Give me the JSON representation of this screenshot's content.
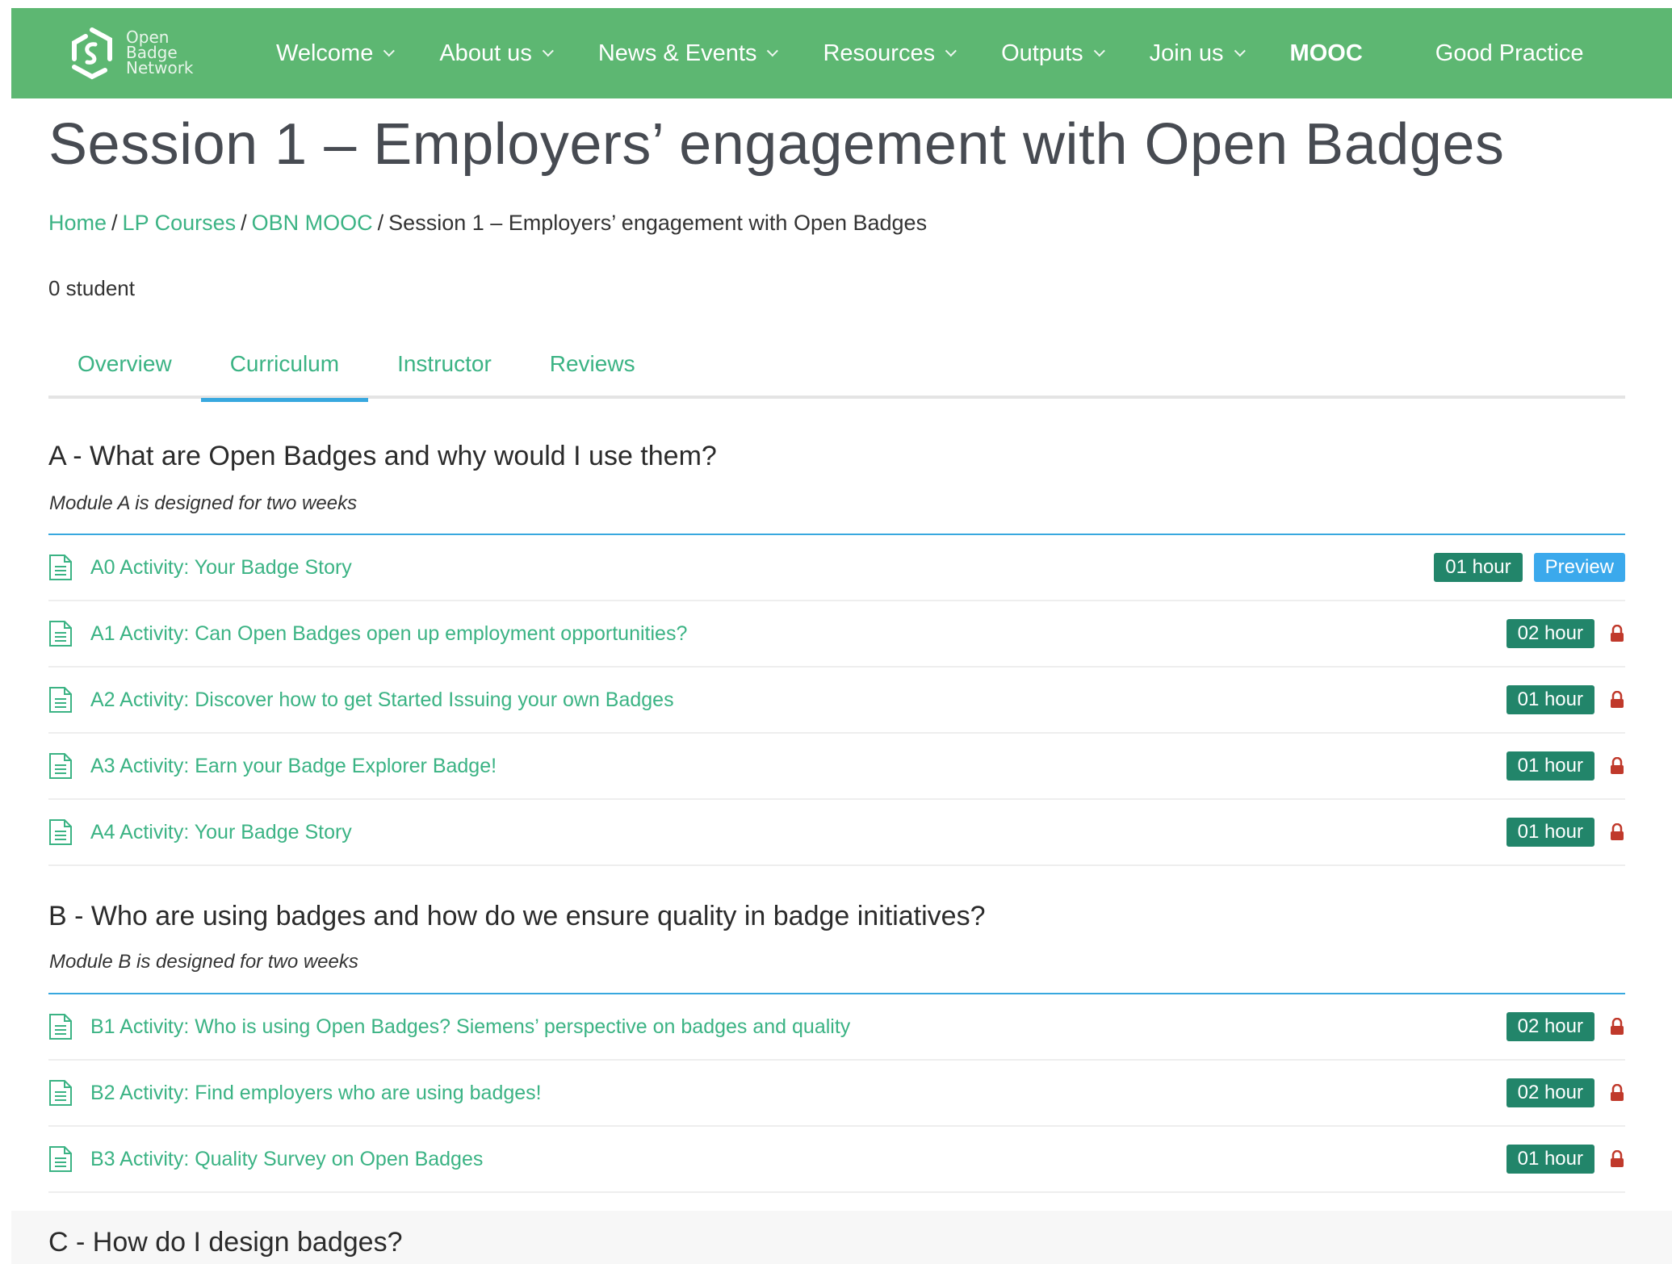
{
  "logo": {
    "text_line1": "Open",
    "text_line2": "Badge",
    "text_line3": "Network",
    "icon": "open-badge-network-logo"
  },
  "nav": [
    {
      "label": "Welcome",
      "has_dropdown": true
    },
    {
      "label": "About us",
      "has_dropdown": true
    },
    {
      "label": "News & Events",
      "has_dropdown": true
    },
    {
      "label": "Resources",
      "has_dropdown": true
    },
    {
      "label": "Outputs",
      "has_dropdown": true
    },
    {
      "label": "Join us",
      "has_dropdown": true
    },
    {
      "label": "MOOC",
      "has_dropdown": false,
      "active": true
    },
    {
      "label": "Good Practice",
      "has_dropdown": false
    }
  ],
  "page_title": "Session 1 – Employers’ engagement with Open Badges",
  "breadcrumb": {
    "home": "Home",
    "lp_courses": "LP Courses",
    "obn_mooc": "OBN MOOC",
    "current": "Session 1 – Employers’ engagement with Open Badges",
    "separator": "/"
  },
  "students": "0 student",
  "tabs": [
    {
      "label": "Overview"
    },
    {
      "label": "Curriculum",
      "active": true
    },
    {
      "label": "Instructor"
    },
    {
      "label": "Reviews"
    }
  ],
  "sections": [
    {
      "title": "A - What are Open Badges and why would I use them?",
      "description": "Module A is designed for two weeks",
      "items": [
        {
          "label": "A0 Activity: Your Badge Story",
          "duration": "01 hour",
          "preview": "Preview",
          "locked": false
        },
        {
          "label": "A1 Activity: Can Open Badges open up employment opportunities?",
          "duration": "02 hour",
          "locked": true
        },
        {
          "label": "A2 Activity: Discover how to get Started Issuing your own Badges",
          "duration": "01 hour",
          "locked": true
        },
        {
          "label": "A3 Activity: Earn your Badge Explorer Badge!",
          "duration": "01 hour",
          "locked": true
        },
        {
          "label": "A4 Activity: Your Badge Story",
          "duration": "01 hour",
          "locked": true
        }
      ]
    },
    {
      "title": "B - Who are using badges and how do we ensure quality in badge initiatives?",
      "description": "Module B is designed for two weeks",
      "items": [
        {
          "label": "B1 Activity: Who is using Open Badges? Siemens’ perspective on badges and quality",
          "duration": "02 hour",
          "locked": true
        },
        {
          "label": "B2 Activity: Find employers who are using badges!",
          "duration": "02 hour",
          "locked": true
        },
        {
          "label": "B3 Activity: Quality Survey on Open Badges",
          "duration": "01 hour",
          "locked": true
        }
      ]
    },
    {
      "title": "C - How do I design badges?"
    }
  ],
  "colors": {
    "nav_bg": "#5db772",
    "link_green": "#3bb384",
    "duration_badge": "#22856a",
    "preview_badge": "#3ba9ec",
    "accent_blue": "#38a8df",
    "lock_red": "#c0392b"
  }
}
